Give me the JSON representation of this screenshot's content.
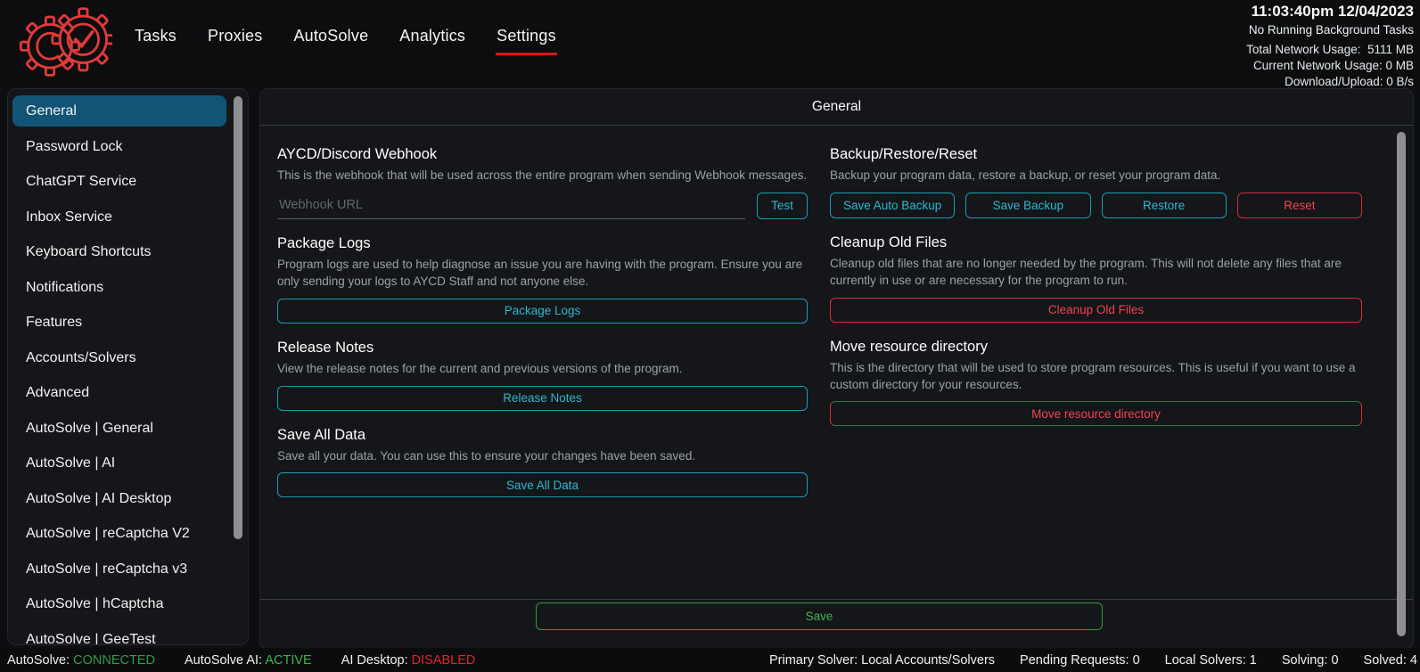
{
  "colors": {
    "accent_teal": "#2fb7cf",
    "accent_red": "#ef4452",
    "accent_green": "#45b551",
    "nav_underline_red": "#e11212",
    "selected_sidebar_bg": "#115476",
    "status_connected_green": "#2f9e44",
    "status_active_green": "#3bb54a",
    "status_disabled_red": "#e3242b",
    "logo_red": "#e03a3a"
  },
  "header": {
    "logo": "aycd-gears-check-logo",
    "nav": [
      "Tasks",
      "Proxies",
      "AutoSolve",
      "Analytics",
      "Settings"
    ],
    "active_nav": "Settings",
    "clock": "11:03:40pm 12/04/2023",
    "background_tasks": "No Running Background Tasks",
    "stats": [
      "Total Network Usage:  5111 MB",
      "Current Network Usage: 0 MB",
      "Download/Upload: 0 B/s"
    ]
  },
  "sidebar": {
    "selected": "General",
    "items": [
      "General",
      "Password Lock",
      "ChatGPT Service",
      "Inbox Service",
      "Keyboard Shortcuts",
      "Notifications",
      "Features",
      "Accounts/Solvers",
      "Advanced",
      "AutoSolve | General",
      "AutoSolve | AI",
      "AutoSolve | AI Desktop",
      "AutoSolve | reCaptcha V2",
      "AutoSolve | reCaptcha v3",
      "AutoSolve | hCaptcha",
      "AutoSolve | GeeTest"
    ]
  },
  "main": {
    "title": "General",
    "left_sections": {
      "webhook": {
        "heading": "AYCD/Discord Webhook",
        "description": "This is the webhook that will be used across the entire program when sending Webhook messages.",
        "input_placeholder": "Webhook URL",
        "input_value": "",
        "button": "Test"
      },
      "package_logs": {
        "heading": "Package Logs",
        "description": "Program logs are used to help diagnose an issue you are having with the program. Ensure you are only sending your logs to AYCD Staff and not anyone else.",
        "button": "Package Logs"
      },
      "release_notes": {
        "heading": "Release Notes",
        "description": "View the release notes for the current and previous versions of the program.",
        "button": "Release Notes"
      },
      "save_all_data": {
        "heading": "Save All Data",
        "description": "Save all your data. You can use this to ensure your changes have been saved.",
        "button": "Save All Data"
      }
    },
    "right_sections": {
      "backup": {
        "heading": "Backup/Restore/Reset",
        "description": "Backup your program data, restore a backup, or reset your program data.",
        "buttons": [
          "Save Auto Backup",
          "Save Backup",
          "Restore",
          "Reset"
        ]
      },
      "cleanup": {
        "heading": "Cleanup Old Files",
        "description": "Cleanup old files that are no longer needed by the program. This will not delete any files that are currently in use or are necessary for the program to run.",
        "button": "Cleanup Old Files"
      },
      "move_resource": {
        "heading": "Move resource directory",
        "description": "This is the directory that will be used to store program resources. This is useful if you want to use a custom directory for your resources.",
        "button": "Move resource directory"
      }
    },
    "save_label": "Save"
  },
  "statusbar": {
    "left": [
      {
        "label": "AutoSolve:",
        "value": "CONNECTED",
        "color": "#2f9e44"
      },
      {
        "label": "AutoSolve AI:",
        "value": "ACTIVE",
        "color": "#3bb54a"
      },
      {
        "label": "AI Desktop:",
        "value": "DISABLED",
        "color": "#e3242b"
      }
    ],
    "right": [
      "Primary Solver: Local Accounts/Solvers",
      "Pending Requests: 0",
      "Local Solvers: 1",
      "Solving: 0",
      "Solved: 4"
    ]
  }
}
